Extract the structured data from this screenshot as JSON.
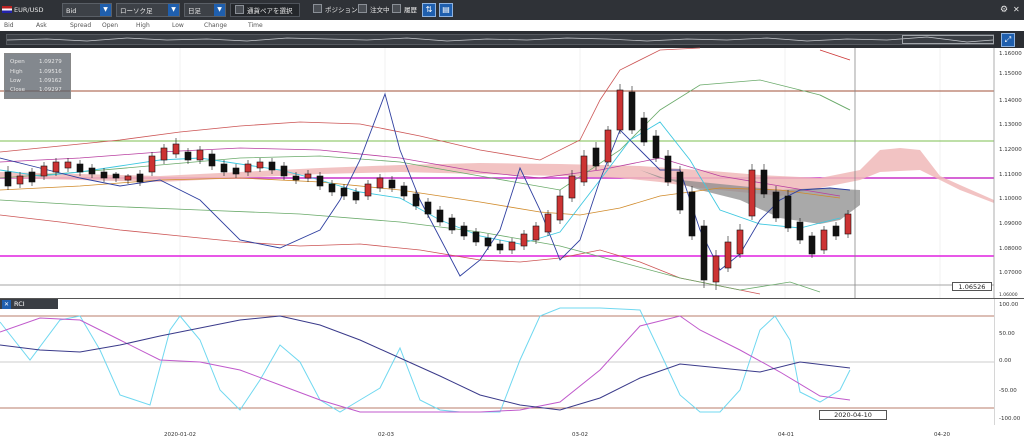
{
  "toolbar": {
    "symbol": "EUR/USD",
    "price_type": "Bid",
    "chart_type": "ローソク足",
    "timeframe": "日足",
    "select_pair": "通貨ペアを選択",
    "position": "ポジション",
    "orders": "注文中",
    "history": "履歴"
  },
  "legend": [
    "Bid",
    "Ask",
    "Spread",
    "Open",
    "High",
    "Low",
    "Change",
    "Time"
  ],
  "ohlc": {
    "open_label": "Open",
    "open": "1.09279",
    "high_label": "High",
    "high": "1.09516",
    "low_label": "Low",
    "low": "1.09162",
    "close_label": "Close",
    "close": "1.09297"
  },
  "price_axis": [
    "1.15000",
    "1.14000",
    "1.13000",
    "1.12000",
    "1.11000",
    "1.10000",
    "1.09000",
    "1.08000",
    "1.07000",
    "1.06000"
  ],
  "price_axis_top_partial": "1.16000",
  "current_price_label": "1.06526",
  "rci": {
    "label": "RCI",
    "axis": [
      "100.00",
      "50.00",
      "0.00",
      "-50.00",
      "-100.00"
    ]
  },
  "cursor_date": "2020-04-10",
  "time_axis": [
    "2020-01-02",
    "02-03",
    "03-02",
    "04-01",
    "04-20"
  ],
  "colors": {
    "up": "#cc3333",
    "down": "#111111",
    "toolbar": "#2f3237",
    "accent": "#1f5fae"
  }
}
